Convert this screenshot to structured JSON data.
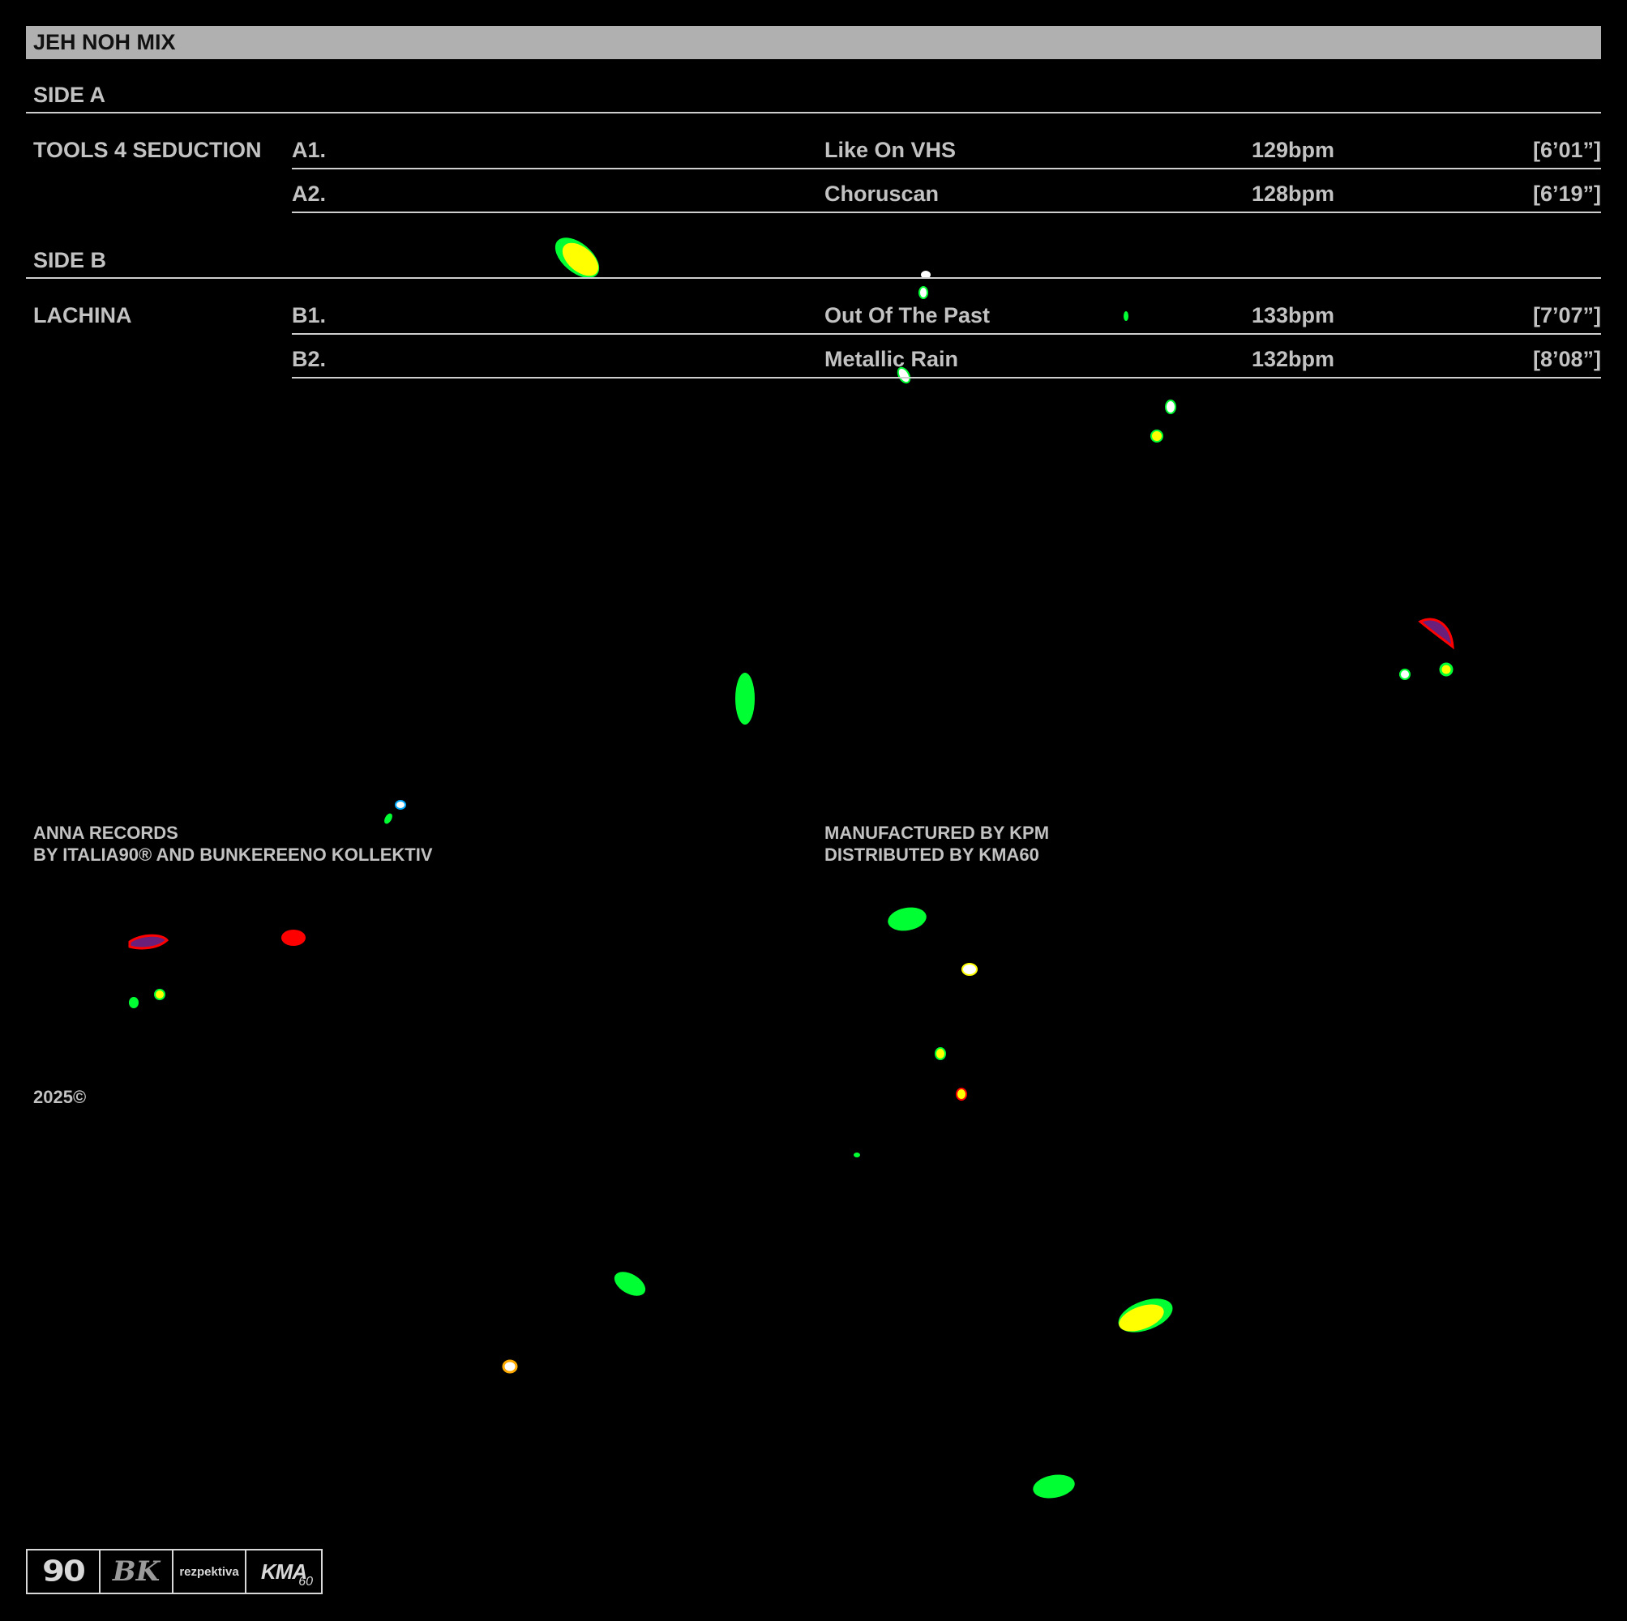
{
  "title": "JEH NOH MIX",
  "sides": [
    {
      "label": "SIDE A",
      "artist": "TOOLS 4 SEDUCTION",
      "tracks": [
        {
          "num": "A1.",
          "name": "Like On VHS",
          "bpm": "129bpm",
          "duration": "[6’01”]"
        },
        {
          "num": "A2.",
          "name": "Choruscan",
          "bpm": "128bpm",
          "duration": "[6’19”]"
        }
      ]
    },
    {
      "label": "SIDE B",
      "artist": "LACHINA",
      "tracks": [
        {
          "num": "B1.",
          "name": "Out Of The Past",
          "bpm": "133bpm",
          "duration": "[7’07”]"
        },
        {
          "num": "B2.",
          "name": "Metallic Rain",
          "bpm": "132bpm",
          "duration": "[8’08”]"
        }
      ]
    }
  ],
  "credits": {
    "label_line1": "ANNA RECORDS",
    "label_line2": "BY ITALIA90® AND BUNKEREENO KOLLEKTIV",
    "manufacture_line1": "MANUFACTURED BY KPM",
    "manufacture_line2": "DISTRIBUTED BY KMA60"
  },
  "copyright": "2025©",
  "logos": {
    "italia90": "90",
    "bunkereeno": "BK",
    "rezpektiva": "rezpektiva",
    "kma": "KMA",
    "kma_sub": "60"
  },
  "colors": {
    "background": "#000000",
    "title_bar": "#b0b0b0",
    "text": "#c2c2c2",
    "blob_green": "#00ff33",
    "blob_yellow": "#ffff00",
    "blob_red": "#ff0000",
    "blob_purple": "#6a1f7a"
  }
}
